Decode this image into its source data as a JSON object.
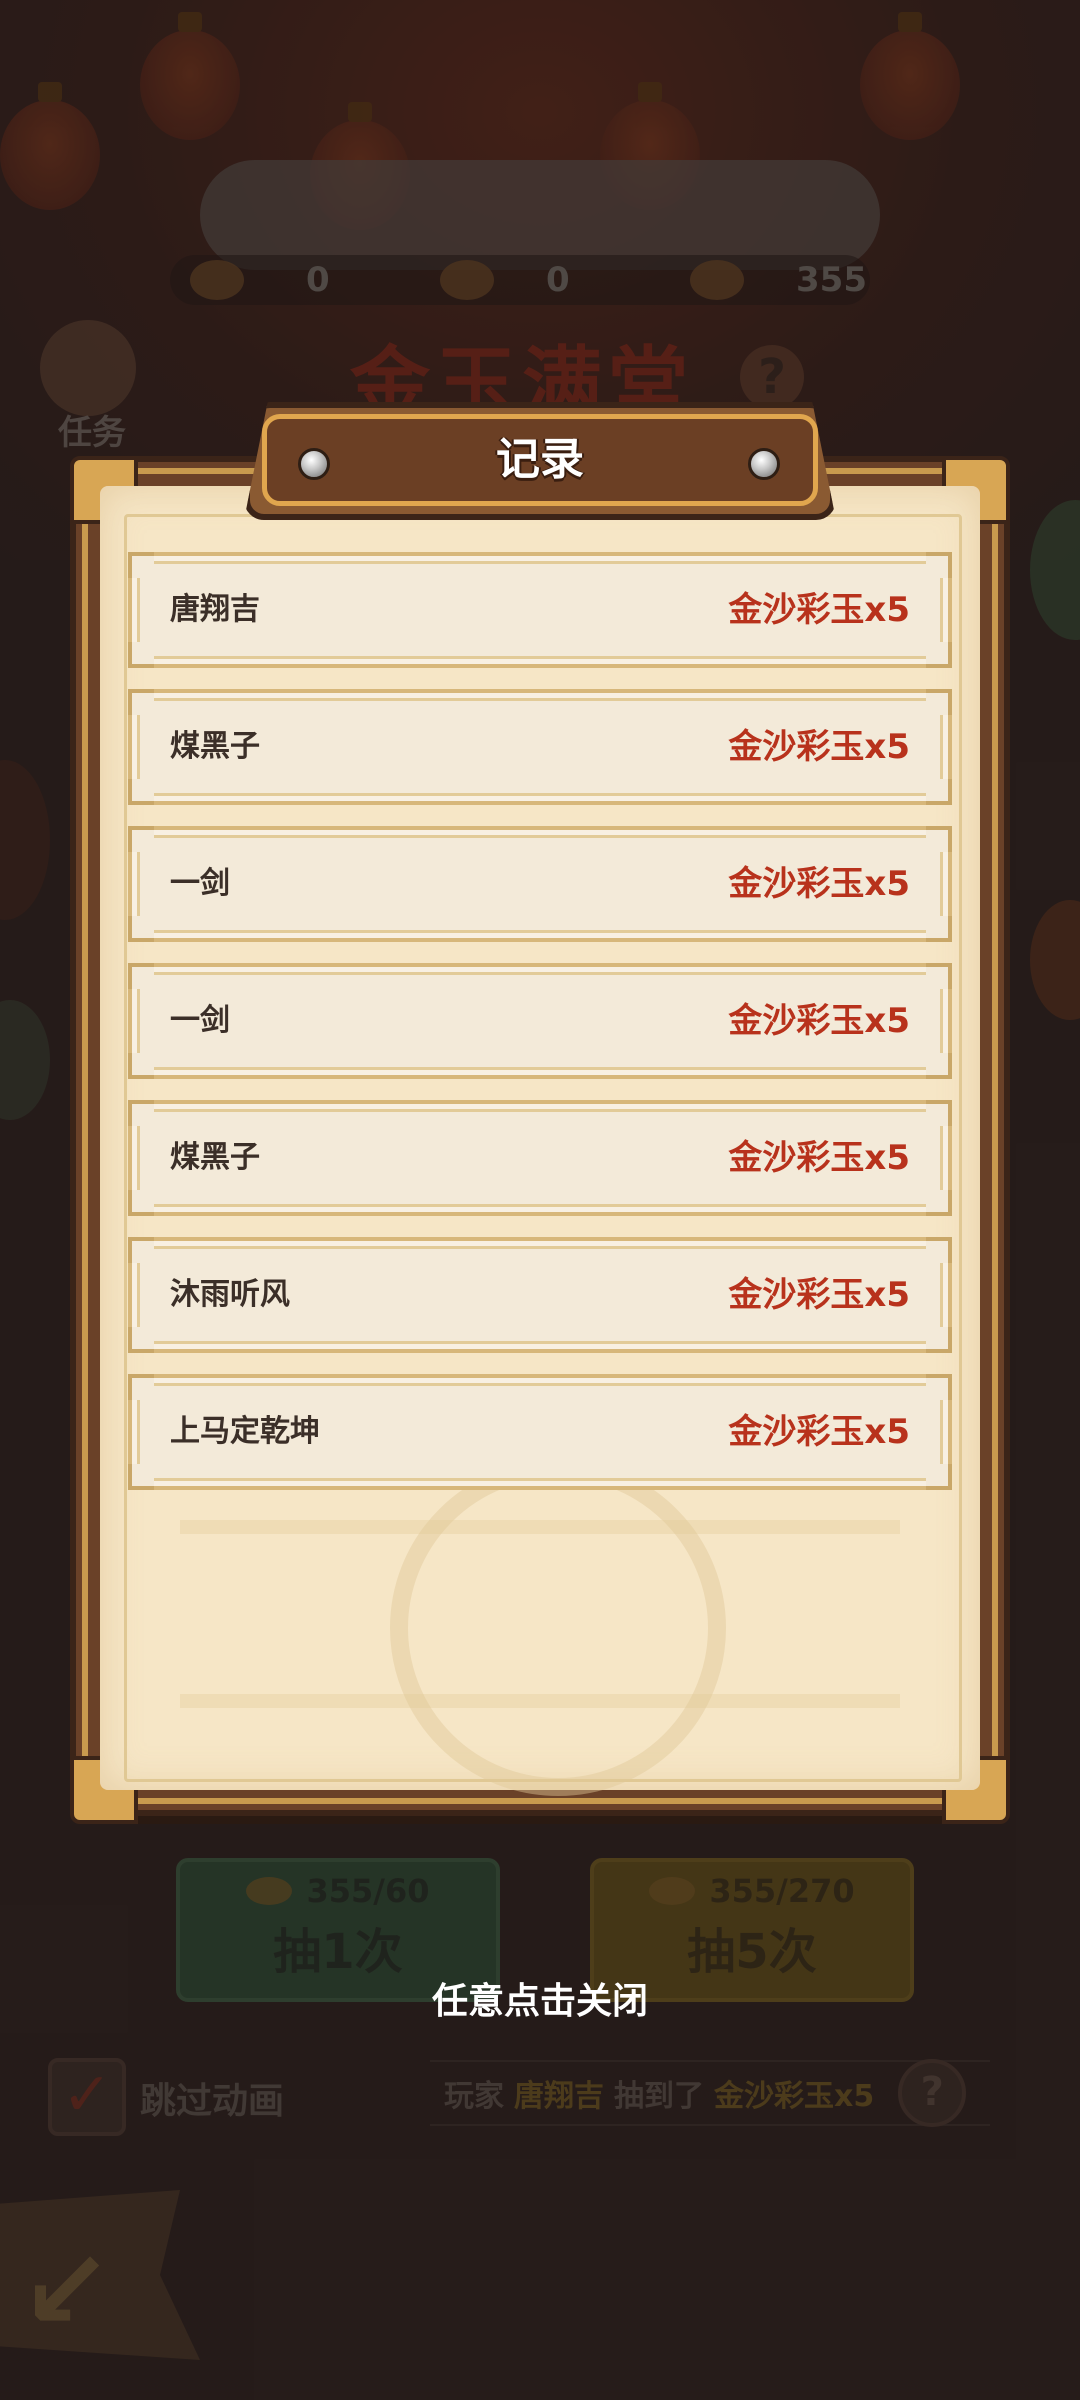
{
  "background": {
    "resources": [
      {
        "icon": "firecracker-icon",
        "value": "0"
      },
      {
        "icon": "lantern-token-icon",
        "value": "0"
      },
      {
        "icon": "gold-ingot-icon",
        "value": "355"
      }
    ],
    "event_title": "金玉满堂",
    "help_glyph": "?",
    "task_label": "任务",
    "draw_buttons": [
      {
        "cost": "355/60",
        "label": "抽1次",
        "color": "#2f4a36"
      },
      {
        "cost": "355/270",
        "label": "抽5次",
        "color": "#5f4d1e"
      }
    ],
    "skip_animation": {
      "label": "跳过动画",
      "checked": true,
      "check_glyph": "✓"
    },
    "ticker": {
      "prefix": "玩家",
      "player": "唐翔吉",
      "middle": "抽到了",
      "item": "金沙彩玉x5"
    },
    "back_glyph": "↙"
  },
  "modal": {
    "title": "记录",
    "records": [
      {
        "name": "唐翔吉",
        "reward": "金沙彩玉x5"
      },
      {
        "name": "煤黑子",
        "reward": "金沙彩玉x5"
      },
      {
        "name": "一剑",
        "reward": "金沙彩玉x5"
      },
      {
        "name": "一剑",
        "reward": "金沙彩玉x5"
      },
      {
        "name": "煤黑子",
        "reward": "金沙彩玉x5"
      },
      {
        "name": "沐雨听风",
        "reward": "金沙彩玉x5"
      },
      {
        "name": "上马定乾坤",
        "reward": "金沙彩玉x5"
      }
    ],
    "reward_color": "#b8321c"
  },
  "close_hint": "任意点击关闭"
}
